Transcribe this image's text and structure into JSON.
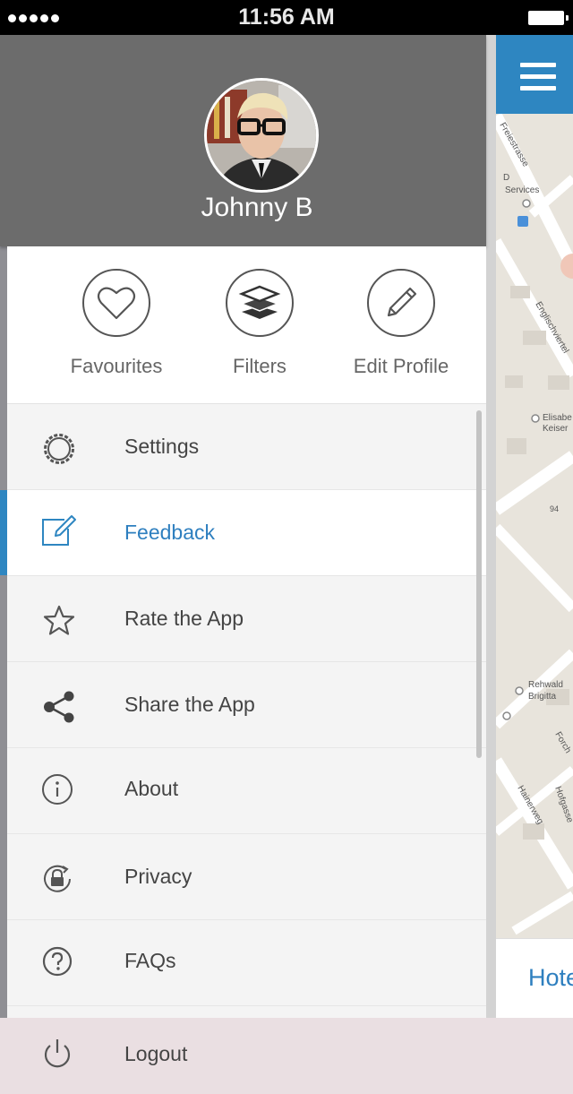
{
  "status_bar": {
    "time": "11:56 AM"
  },
  "profile": {
    "name": "Johnny B"
  },
  "quick_actions": [
    {
      "label": "Favourites",
      "icon": "heart-icon"
    },
    {
      "label": "Filters",
      "icon": "layers-icon"
    },
    {
      "label": "Edit Profile",
      "icon": "pencil-icon"
    }
  ],
  "menu": {
    "items": [
      {
        "label": "Settings",
        "icon": "gear-icon"
      },
      {
        "label": "Feedback",
        "icon": "edit-note-icon",
        "active": true
      },
      {
        "label": "Rate the App",
        "icon": "star-icon"
      },
      {
        "label": "Share the App",
        "icon": "share-icon"
      },
      {
        "label": "About",
        "icon": "info-icon"
      },
      {
        "label": "Privacy",
        "icon": "lock-icon"
      },
      {
        "label": "FAQs",
        "icon": "question-icon"
      }
    ],
    "logout_label": "Logout"
  },
  "map": {
    "labels": [
      "Freiestrasse",
      "Diamond Services",
      "Englischviertel",
      "Elisabe Keiser",
      "Rehwald Brigitta",
      "Hainerweg",
      "Hofgasse",
      "Forch",
      "94"
    ],
    "hotel_tab": "Hote"
  },
  "colors": {
    "accent": "#2e86c1",
    "header_bg": "#6c6c6c",
    "drawer_bg": "#f4f4f4",
    "logout_bg": "#eadfe2"
  }
}
